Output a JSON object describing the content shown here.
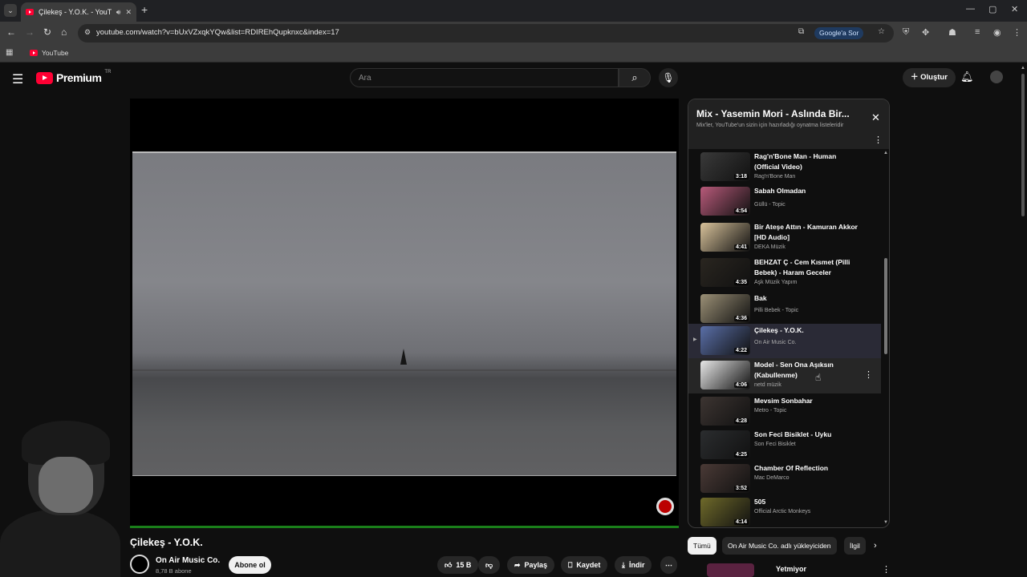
{
  "browser": {
    "tab_title": "Çilekeş - Y.O.K. - YouTube",
    "url": "youtube.com/watch?v=bUxVZxqkYQw&list=RDIREhQupknxc&index=17",
    "google_ask_label": "Google'a Sor",
    "bookmark_label": "YouTube"
  },
  "header": {
    "logo_text": "Premium",
    "logo_region": "TR",
    "search_placeholder": "Ara",
    "create_label": "Oluştur"
  },
  "video": {
    "title": "Çilekeş - Y.O.K.",
    "channel": "On Air Music Co.",
    "subscribers": "8,78 B abone",
    "subscribe_label": "Abone ol",
    "likes": "15 B",
    "share_label": "Paylaş",
    "save_label": "Kaydet",
    "download_label": "İndir"
  },
  "playlist": {
    "title": "Mix - Yasemin Mori - Aslında Bir...",
    "subtitle": "Mix'ler, YouTube'un sizin için hazırladığı oynatma listeleridir",
    "items": [
      {
        "title": "Rag'n'Bone Man - Human (Official Video)",
        "channel": "Rag'n'Bone Man",
        "duration": "3:18",
        "color": "#3a3a3a"
      },
      {
        "title": "Sabah Olmadan",
        "channel": "Güllü - Topic",
        "duration": "4:54",
        "color": "#b85a7a"
      },
      {
        "title": "Bir Ateşe Attın - Kamuran Akkor [HD Audio]",
        "channel": "DEKA Müzik",
        "duration": "4:41",
        "color": "#d8c29a"
      },
      {
        "title": "BEHZAT Ç - Cem Kısmet (Pilli Bebek) - Haram Geceler",
        "channel": "Aşk Müzik Yapım",
        "duration": "4:35",
        "color": "#2a2620"
      },
      {
        "title": "Bak",
        "channel": "Pilli Bebek - Topic",
        "duration": "4:36",
        "color": "#9b9076"
      },
      {
        "title": "Çilekeş - Y.O.K.",
        "channel": "On Air Music Co.",
        "duration": "4:22",
        "color": "#5a6fa8"
      },
      {
        "title": "Model - Sen Ona Aşıksın (Kabullenme)",
        "channel": "netd müzik",
        "duration": "4:06",
        "color": "#e8e8e8"
      },
      {
        "title": "Mevsim Sonbahar",
        "channel": "Metro - Topic",
        "duration": "4:28",
        "color": "#3d3532"
      },
      {
        "title": "Son Feci Bisiklet - Uyku",
        "channel": "Son Feci Bisiklet",
        "duration": "4:25",
        "color": "#2b2d2f"
      },
      {
        "title": "Chamber Of Reflection",
        "channel": "Mac DeMarco",
        "duration": "3:52",
        "color": "#4a3a36"
      },
      {
        "title": "505",
        "channel": "Official Arctic Monkeys",
        "duration": "4:14",
        "color": "#6f6a2a"
      }
    ]
  },
  "chips": {
    "all": "Tümü",
    "uploader": "On Air Music Co. adlı yükleyiciden",
    "related": "İlgil"
  },
  "recommendation": {
    "title": "Yetmiyor"
  }
}
